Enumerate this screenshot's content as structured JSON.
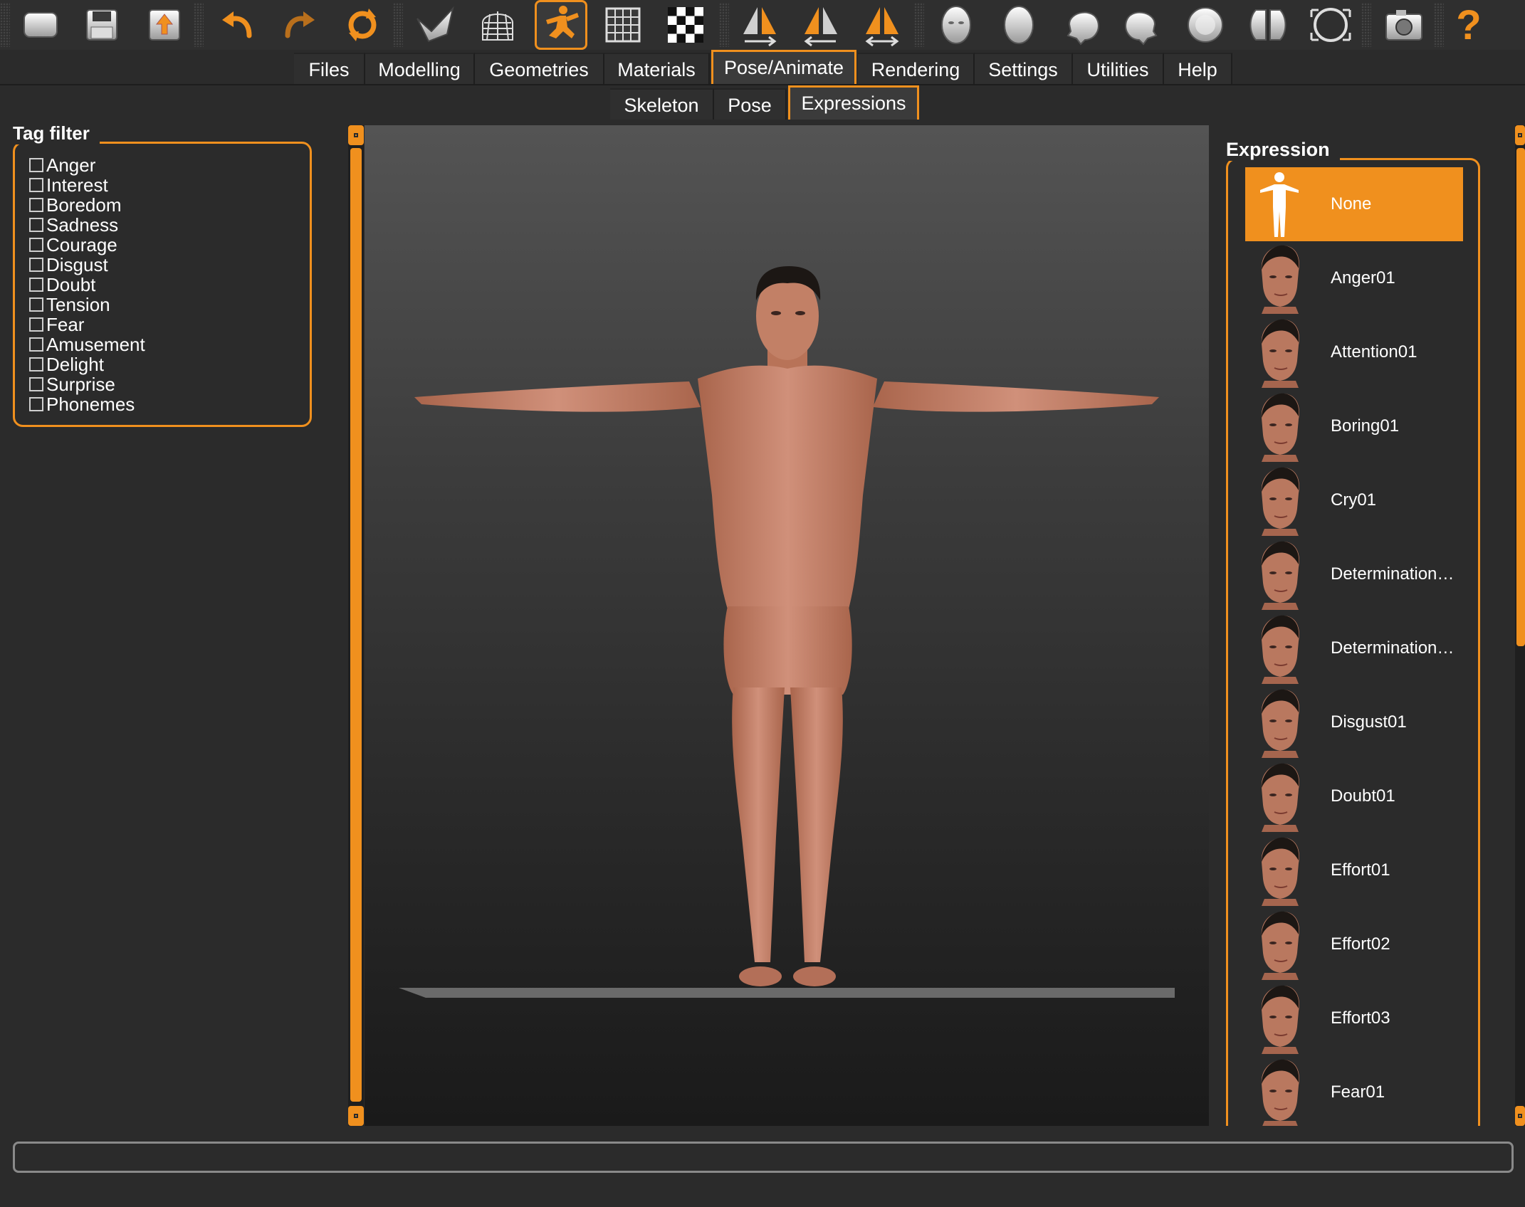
{
  "toolbar": {
    "buttons": [
      {
        "icon": "save-scene-icon"
      },
      {
        "icon": "save-icon"
      },
      {
        "icon": "export-icon"
      },
      {
        "icon": "undo-icon"
      },
      {
        "icon": "redo-icon"
      },
      {
        "icon": "reset-icon"
      },
      {
        "icon": "smooth-icon"
      },
      {
        "icon": "wireframe-icon"
      },
      {
        "icon": "pose-icon"
      },
      {
        "icon": "grid-icon"
      },
      {
        "icon": "checker-icon"
      },
      {
        "icon": "symmetry-right-icon"
      },
      {
        "icon": "symmetry-left-icon"
      },
      {
        "icon": "symmetry-both-icon"
      },
      {
        "icon": "front-view-icon"
      },
      {
        "icon": "back-view-icon"
      },
      {
        "icon": "left-view-icon"
      },
      {
        "icon": "right-view-icon"
      },
      {
        "icon": "top-view-icon"
      },
      {
        "icon": "bottom-view-icon"
      },
      {
        "icon": "reset-camera-icon"
      },
      {
        "icon": "screenshot-icon"
      },
      {
        "icon": "help-icon"
      }
    ],
    "active": "pose-icon",
    "help_label": "?"
  },
  "main_tabs": {
    "items": [
      "Files",
      "Modelling",
      "Geometries",
      "Materials",
      "Pose/Animate",
      "Rendering",
      "Settings",
      "Utilities",
      "Help"
    ],
    "active": "Pose/Animate"
  },
  "sub_tabs": {
    "items": [
      "Skeleton",
      "Pose",
      "Expressions"
    ],
    "active": "Expressions"
  },
  "tag_filter": {
    "title": "Tag filter",
    "items": [
      "Anger",
      "Interest",
      "Boredom",
      "Sadness",
      "Courage",
      "Disgust",
      "Doubt",
      "Tension",
      "Fear",
      "Amusement",
      "Delight",
      "Surprise",
      "Phonemes"
    ]
  },
  "expression": {
    "title": "Expression",
    "selected": "None",
    "items": [
      "None",
      "Anger01",
      "Attention01",
      "Boring01",
      "Cry01",
      "Determination…",
      "Determination…",
      "Disgust01",
      "Doubt01",
      "Effort01",
      "Effort02",
      "Effort03",
      "Fear01"
    ]
  },
  "colors": {
    "accent": "#f0901e",
    "background": "#2b2b2b",
    "skin": "#c98466"
  },
  "status_bar": {
    "text": ""
  }
}
